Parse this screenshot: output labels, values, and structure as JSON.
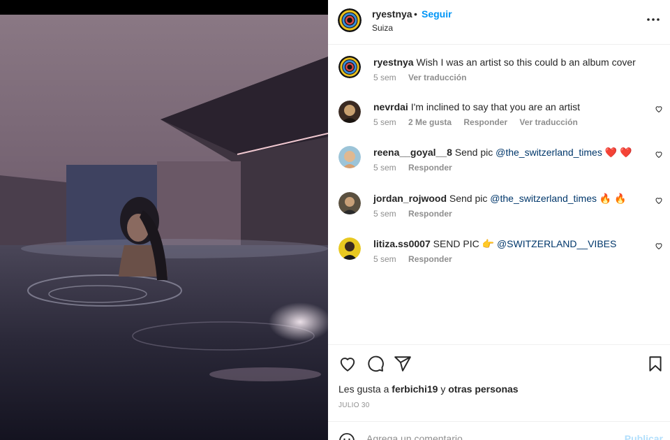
{
  "post": {
    "author": "ryestnya",
    "separator": "•",
    "follow_label": "Seguir",
    "location": "Suiza",
    "more_icon": "more-horizontal-icon"
  },
  "caption": {
    "user": "ryestnya",
    "text": "Wish I was an artist so this could b an album cover",
    "time": "5 sem",
    "translate": "Ver traducción"
  },
  "comments": [
    {
      "user": "nevrdai",
      "text": "I'm inclined to say that you are an artist",
      "time": "5 sem",
      "likes": "2 Me gusta",
      "reply": "Responder",
      "translate": "Ver traducción"
    },
    {
      "user": "reena__goyal__8",
      "text": "Send pic",
      "mention": "@the_switzerland_times",
      "emoji": "❤️ ❤️",
      "time": "5 sem",
      "reply": "Responder"
    },
    {
      "user": "jordan_rojwood",
      "text": "Send pic",
      "mention": "@the_switzerland_times",
      "emoji": "🔥 🔥",
      "time": "5 sem",
      "reply": "Responder"
    },
    {
      "user": "litiza.ss0007",
      "text": "SEND PIC 👉",
      "mention": "@SWITZERLAND__VIBES",
      "emoji": "",
      "time": "5 sem",
      "reply": "Responder"
    }
  ],
  "actions": {
    "like_icon": "heart-icon",
    "comment_icon": "comment-icon",
    "share_icon": "send-icon",
    "save_icon": "bookmark-icon"
  },
  "likes": {
    "prefix": "Les gusta a",
    "user": "ferbichi19",
    "conj": "y",
    "others": "otras personas"
  },
  "date": "JULIO 30",
  "add_comment": {
    "placeholder": "Agrega un comentario...",
    "publish_label": "Publicar",
    "emoji_icon": "emoji-icon"
  },
  "colors": {
    "accent": "#0095f6",
    "mention": "#00376b",
    "muted": "#8e8e8e",
    "publish_disabled": "#b2dffc"
  }
}
